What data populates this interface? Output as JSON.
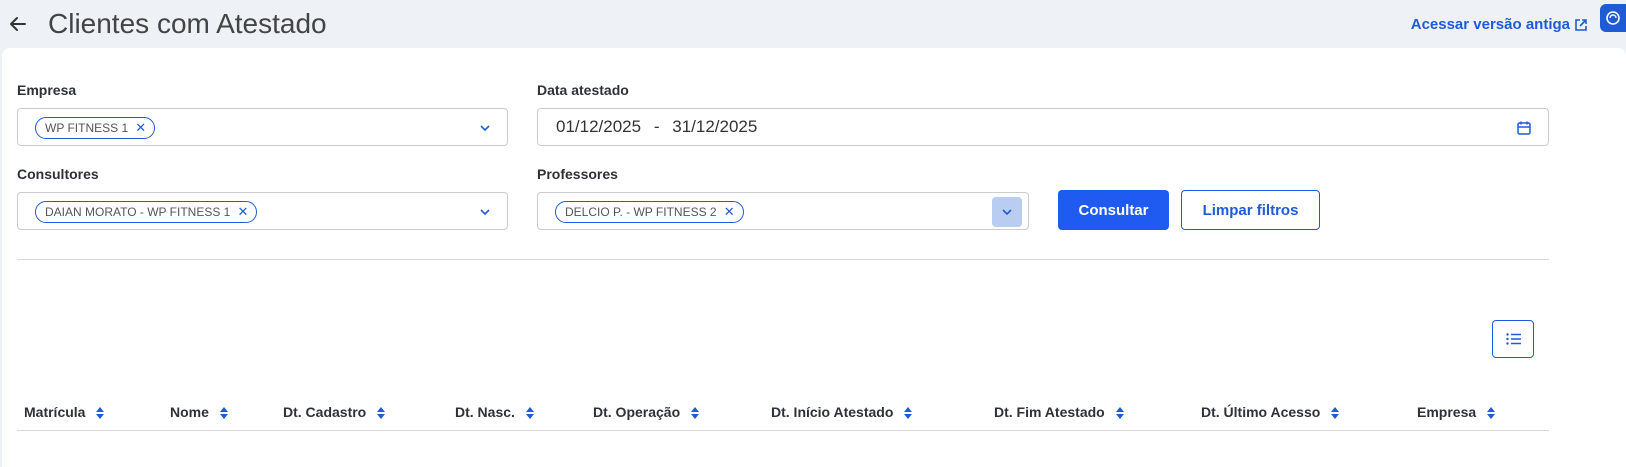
{
  "header": {
    "title": "Clientes com Atestado",
    "old_version_link": "Acessar versão antiga"
  },
  "filters": {
    "empresa": {
      "label": "Empresa",
      "chips": [
        "WP FITNESS 1"
      ]
    },
    "data_atestado": {
      "label": "Data atestado",
      "start": "01/12/2025",
      "separator": "-",
      "end": "31/12/2025"
    },
    "consultores": {
      "label": "Consultores",
      "chips": [
        "DAIAN MORATO - WP FITNESS 1"
      ]
    },
    "professores": {
      "label": "Professores",
      "chips": [
        "DELCIO P. - WP FITNESS 2"
      ]
    }
  },
  "actions": {
    "consultar": "Consultar",
    "limpar": "Limpar filtros"
  },
  "table": {
    "columns": [
      "Matrícula",
      "Nome",
      "Dt. Cadastro",
      "Dt. Nasc.",
      "Dt. Operação",
      "Dt. Início Atestado",
      "Dt. Fim Atestado",
      "Dt. Último Acesso",
      "Empresa"
    ]
  },
  "colors": {
    "accent": "#1f5bd6",
    "primary_button": "#1f5bf0",
    "background": "#eef1f5"
  },
  "icons": [
    "back-arrow-icon",
    "external-link-icon",
    "chevron-down-icon",
    "calendar-icon",
    "list-icon",
    "sort-icon",
    "close-icon"
  ]
}
